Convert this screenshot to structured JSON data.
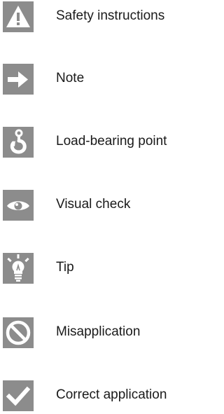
{
  "legend": {
    "items": [
      {
        "icon": "warning-triangle-icon",
        "label": "Safety instructions"
      },
      {
        "icon": "arrow-right-icon",
        "label": "Note"
      },
      {
        "icon": "hook-icon",
        "label": "Load-bearing point"
      },
      {
        "icon": "eye-icon",
        "label": "Visual check"
      },
      {
        "icon": "lightbulb-icon",
        "label": "Tip"
      },
      {
        "icon": "prohibition-icon",
        "label": "Misapplication"
      },
      {
        "icon": "checkmark-icon",
        "label": "Correct application"
      }
    ]
  },
  "colors": {
    "tile_background": "#8c8c8c",
    "icon_foreground": "#ffffff",
    "text": "#1a1a1a"
  }
}
